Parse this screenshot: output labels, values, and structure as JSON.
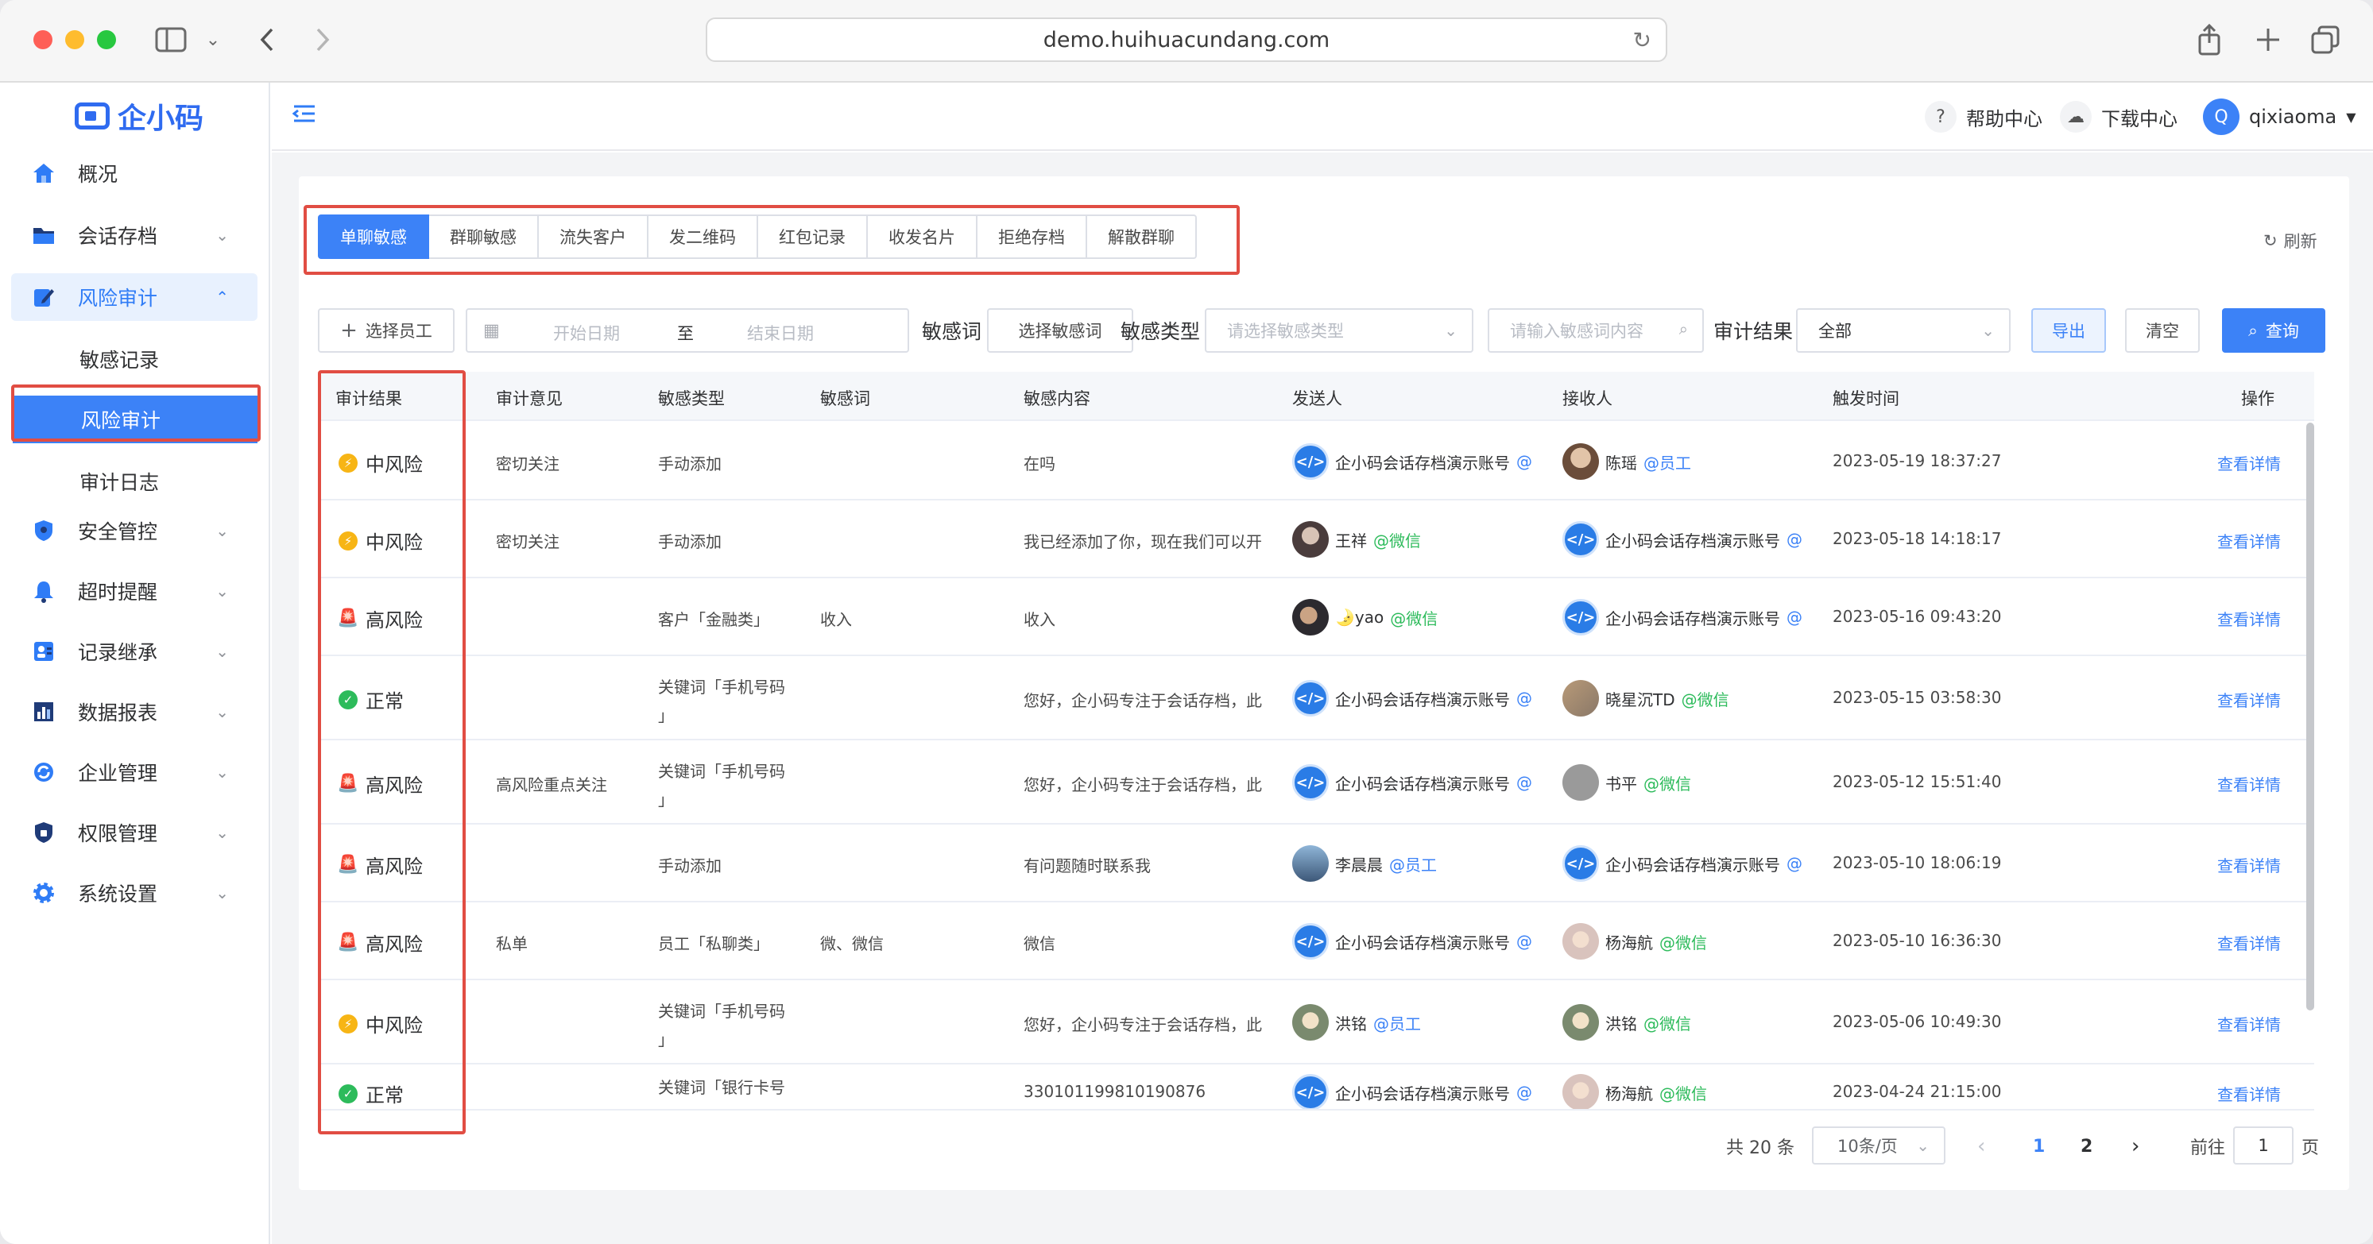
{
  "browser": {
    "url": "demo.huihuacundang.com"
  },
  "logo": {
    "text": "企小码"
  },
  "sidebar": {
    "items": [
      {
        "label": "概况",
        "icon": "home-icon"
      },
      {
        "label": "会话存档",
        "icon": "folder-icon"
      },
      {
        "label": "风险审计",
        "icon": "edit-icon",
        "open": true,
        "children": [
          {
            "label": "敏感记录"
          },
          {
            "label": "风险审计",
            "active": true
          },
          {
            "label": "审计日志"
          }
        ]
      },
      {
        "label": "安全管控",
        "icon": "shield-icon"
      },
      {
        "label": "超时提醒",
        "icon": "bell-icon"
      },
      {
        "label": "记录继承",
        "icon": "person-card-icon"
      },
      {
        "label": "数据报表",
        "icon": "bar-chart-icon"
      },
      {
        "label": "企业管理",
        "icon": "sync-icon"
      },
      {
        "label": "权限管理",
        "icon": "lock-shield-icon"
      },
      {
        "label": "系统设置",
        "icon": "gear-icon"
      }
    ]
  },
  "header": {
    "help": "帮助中心",
    "download": "下载中心",
    "avatar_letter": "Q",
    "username": "qixiaoma"
  },
  "tabs": [
    "单聊敏感",
    "群聊敏感",
    "流失客户",
    "发二维码",
    "红包记录",
    "收发名片",
    "拒绝存档",
    "解散群聊"
  ],
  "refresh": "刷新",
  "filters": {
    "select_employee": "选择员工",
    "start_date": "开始日期",
    "to": "至",
    "end_date": "结束日期",
    "sensitive_word_label": "敏感词",
    "select_sensitive_word": "选择敏感词",
    "sensitive_type_label": "敏感类型",
    "sensitive_type_placeholder": "请选择敏感类型",
    "sensitive_content_placeholder": "请输入敏感词内容",
    "audit_result_label": "审计结果",
    "audit_result_value": "全部",
    "export": "导出",
    "clear": "清空",
    "search": "查询"
  },
  "table": {
    "columns": [
      "审计结果",
      "审计意见",
      "敏感类型",
      "敏感词",
      "敏感内容",
      "发送人",
      "接收人",
      "触发时间",
      "操作"
    ],
    "action_label": "查看详情",
    "rows": [
      {
        "result": "中风险",
        "level": "mid",
        "opinion": "密切关注",
        "type": "手动添加",
        "type2": "",
        "word": "",
        "content": "在吗",
        "sender": "企小码会话存档演示账号",
        "sender_tag": "@",
        "sender_av": "blue",
        "receiver": "陈瑶",
        "receiver_tag": "@员工",
        "receiver_av": "photo1",
        "time": "2023-05-19 18:37:27"
      },
      {
        "result": "中风险",
        "level": "mid",
        "opinion": "密切关注",
        "type": "手动添加",
        "type2": "",
        "word": "",
        "content": "我已经添加了你，现在我们可以开",
        "sender": "王祥",
        "sender_tag": "@微信",
        "sender_av": "photo2",
        "receiver": "企小码会话存档演示账号",
        "receiver_tag": "@",
        "receiver_av": "blue",
        "time": "2023-05-18 14:18:17"
      },
      {
        "result": "高风险",
        "level": "high",
        "opinion": "",
        "type": "客户「金融类」",
        "type2": "",
        "word": "收入",
        "content": "收入",
        "sender": "🌛yao",
        "sender_tag": "@微信",
        "sender_av": "photo3",
        "receiver": "企小码会话存档演示账号",
        "receiver_tag": "@",
        "receiver_av": "blue",
        "time": "2023-05-16 09:43:20"
      },
      {
        "result": "正常",
        "level": "ok",
        "opinion": "",
        "type": "关键词「手机号码",
        "type2": "」",
        "word": "",
        "content": "您好，企小码专注于会话存档，此",
        "sender": "企小码会话存档演示账号",
        "sender_tag": "@",
        "sender_av": "blue",
        "receiver": "晓星沉TD",
        "receiver_tag": "@微信",
        "receiver_av": "photo4",
        "time": "2023-05-15 03:58:30"
      },
      {
        "result": "高风险",
        "level": "high",
        "opinion": "高风险重点关注",
        "type": "关键词「手机号码",
        "type2": "」",
        "word": "",
        "content": "您好，企小码专注于会话存档，此",
        "sender": "企小码会话存档演示账号",
        "sender_tag": "@",
        "sender_av": "blue",
        "receiver": "书平",
        "receiver_tag": "@微信",
        "receiver_av": "photo5",
        "time": "2023-05-12 15:51:40"
      },
      {
        "result": "高风险",
        "level": "high",
        "opinion": "",
        "type": "手动添加",
        "type2": "",
        "word": "",
        "content": "有问题随时联系我",
        "sender": "李晨晨",
        "sender_tag": "@员工",
        "sender_av": "photo6",
        "receiver": "企小码会话存档演示账号",
        "receiver_tag": "@",
        "receiver_av": "blue",
        "time": "2023-05-10 18:06:19"
      },
      {
        "result": "高风险",
        "level": "high",
        "opinion": "私单",
        "type": "员工「私聊类」",
        "type2": "",
        "word": "微、微信",
        "content": "微信",
        "sender": "企小码会话存档演示账号",
        "sender_tag": "@",
        "sender_av": "blue",
        "receiver": "杨海航",
        "receiver_tag": "@微信",
        "receiver_av": "photo7",
        "time": "2023-05-10 16:36:30"
      },
      {
        "result": "中风险",
        "level": "mid",
        "opinion": "",
        "type": "关键词「手机号码",
        "type2": "」",
        "word": "",
        "content": "您好，企小码专注于会话存档，此",
        "sender": "洪铭",
        "sender_tag": "@员工",
        "sender_av": "photo8",
        "receiver": "洪铭",
        "receiver_tag": "@微信",
        "receiver_av": "photo8",
        "time": "2023-05-06 10:49:30"
      },
      {
        "result": "正常",
        "level": "ok",
        "opinion": "",
        "type": "关键词「银行卡号",
        "type2": "",
        "word": "",
        "content": "330101199810190876",
        "sender": "企小码会话存档演示账号",
        "sender_tag": "@",
        "sender_av": "blue",
        "receiver": "杨海航",
        "receiver_tag": "@微信",
        "receiver_av": "photo7",
        "time": "2023-04-24 21:15:00"
      }
    ]
  },
  "pagination": {
    "total": "共 20 条",
    "page_size": "10条/页",
    "pages": [
      "1",
      "2"
    ],
    "current": "1",
    "goto_label": "前往",
    "goto_value": "1",
    "page_suffix": "页"
  },
  "colors": {
    "primary": "#3c82f7",
    "highlight_outline": "#e14d43",
    "wechat_green": "#2dbb5b",
    "mid_risk": "#f7b515",
    "high_risk": "#e5352b"
  }
}
